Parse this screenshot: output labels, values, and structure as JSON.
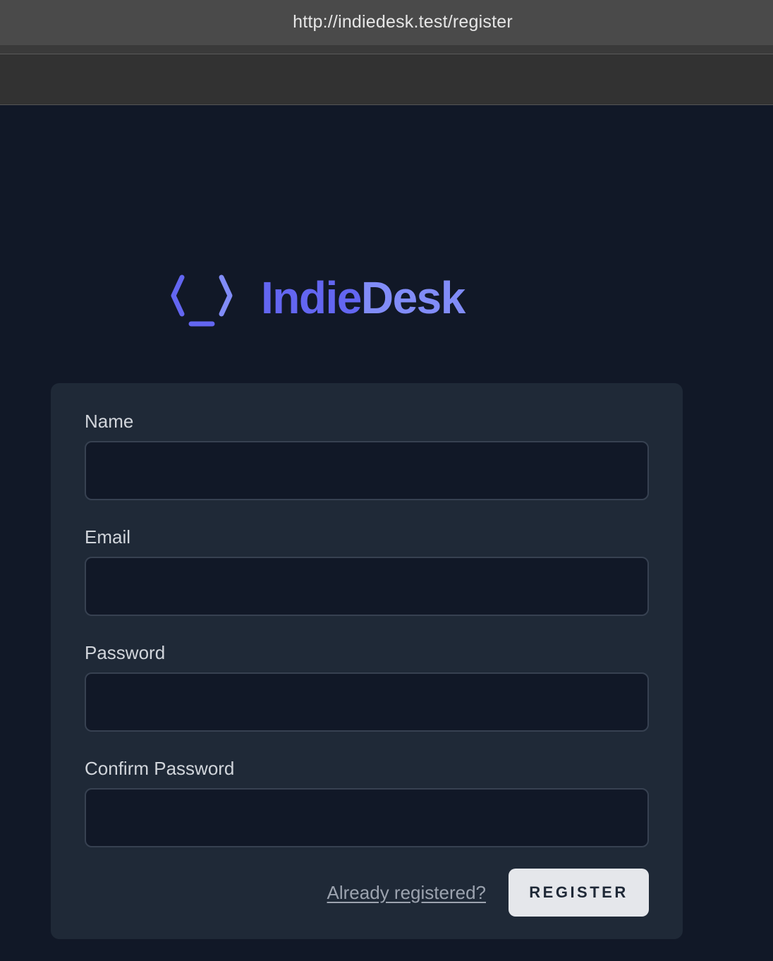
{
  "browser": {
    "url": "http://indiedesk.test/register"
  },
  "brand": {
    "name_part1": "Indie",
    "name_part2": "Desk",
    "icon": "code-bracket-logo-icon",
    "colors": {
      "primary": "#6366f1",
      "secondary": "#818cf8"
    }
  },
  "form": {
    "fields": [
      {
        "label": "Name",
        "value": ""
      },
      {
        "label": "Email",
        "value": ""
      },
      {
        "label": "Password",
        "value": ""
      },
      {
        "label": "Confirm Password",
        "value": ""
      }
    ],
    "login_link": "Already registered?",
    "submit_label": "REGISTER"
  },
  "colors": {
    "page_background": "#111827",
    "card_background": "#1f2937",
    "input_background": "#111827",
    "input_border": "#374151",
    "button_background": "#e5e7eb"
  }
}
